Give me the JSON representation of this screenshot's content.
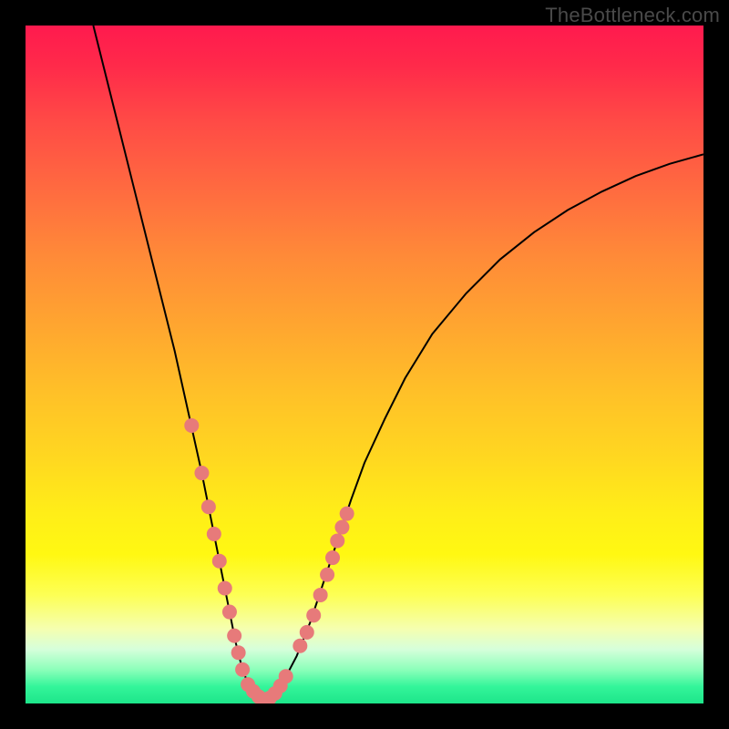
{
  "watermark": "TheBottleneck.com",
  "chart_data": {
    "type": "line",
    "title": "",
    "xlabel": "",
    "ylabel": "",
    "xlim": [
      0,
      100
    ],
    "ylim": [
      0,
      100
    ],
    "grid": false,
    "legend": false,
    "series": [
      {
        "name": "curve",
        "x": [
          10,
          12,
          14,
          16,
          18,
          20,
          22,
          24,
          26,
          27,
          28,
          29,
          30,
          31,
          32,
          33,
          34,
          35,
          36,
          37,
          38,
          40,
          42,
          44,
          46,
          48,
          50,
          53,
          56,
          60,
          65,
          70,
          75,
          80,
          85,
          90,
          95,
          100
        ],
        "y": [
          100,
          92,
          84,
          76,
          68,
          60,
          52,
          43,
          34,
          29,
          24,
          19,
          14,
          9,
          5,
          2.5,
          1.2,
          0.5,
          0.8,
          1.8,
          3.2,
          7,
          12,
          18,
          24,
          30,
          35.5,
          42,
          48,
          54.5,
          60.5,
          65.5,
          69.5,
          72.8,
          75.5,
          77.8,
          79.6,
          81
        ],
        "markers_x": [
          24.5,
          26,
          27,
          27.8,
          28.6,
          29.4,
          30.1,
          30.8,
          31.4,
          32.0,
          32.8,
          33.6,
          34.4,
          35.2,
          36.0,
          36.8,
          37.6,
          38.4,
          40.5,
          41.5,
          42.5,
          43.5,
          44.5,
          45.3,
          46.0,
          46.7,
          47.4
        ],
        "markers_y": [
          41,
          34,
          29,
          25,
          21,
          17,
          13.5,
          10,
          7.5,
          5,
          2.8,
          1.8,
          1.0,
          0.6,
          0.8,
          1.5,
          2.6,
          4.0,
          8.5,
          10.5,
          13.0,
          16.0,
          19.0,
          21.5,
          24.0,
          26.0,
          28.0
        ]
      }
    ]
  }
}
